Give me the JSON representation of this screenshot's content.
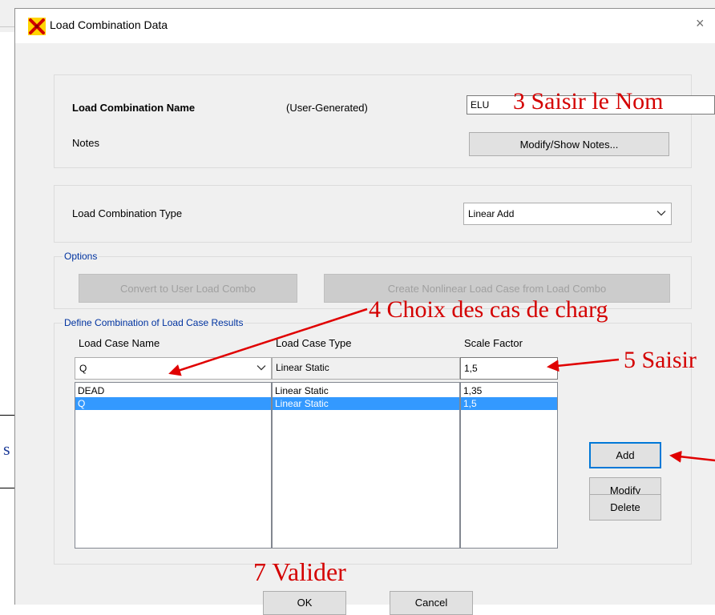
{
  "window": {
    "title": "Load Combination Data",
    "close_glyph": "×",
    "icon": "sap-app-icon"
  },
  "combo_name": {
    "label": "Load Combination Name",
    "qualifier": "(User-Generated)",
    "value": "ELU"
  },
  "notes": {
    "label": "Notes",
    "button": "Modify/Show Notes..."
  },
  "combo_type": {
    "label": "Load Combination Type",
    "selected": "Linear Add"
  },
  "options": {
    "legend": "Options",
    "convert_button": "Convert to User Load Combo",
    "create_button": "Create Nonlinear Load Case from Load Combo"
  },
  "define": {
    "legend": "Define Combination of Load Case Results",
    "headers": {
      "name": "Load Case Name",
      "type": "Load Case Type",
      "scale": "Scale Factor"
    },
    "input": {
      "name": "Q",
      "type": "Linear Static",
      "scale": "1,5"
    },
    "rows": [
      {
        "name": "DEAD",
        "type": "Linear Static",
        "scale": "1,35"
      },
      {
        "name": "Q",
        "type": "Linear Static",
        "scale": "1,5"
      }
    ],
    "selected_row": 1,
    "buttons": {
      "add": "Add",
      "modify": "Modify",
      "delete": "Delete"
    }
  },
  "footer": {
    "ok": "OK",
    "cancel": "Cancel"
  },
  "annotations": {
    "a3": "3 Saisir le Nom",
    "a4": "4 Choix des cas de charg",
    "a5": "5 Saisir",
    "a7": "7 Valider",
    "left_fragment": "s",
    "color": "#d40000"
  },
  "colors": {
    "selection": "#3399ff",
    "accent": "#0078d7",
    "annotation": "#d40000",
    "legend_text": "#0033a0"
  }
}
